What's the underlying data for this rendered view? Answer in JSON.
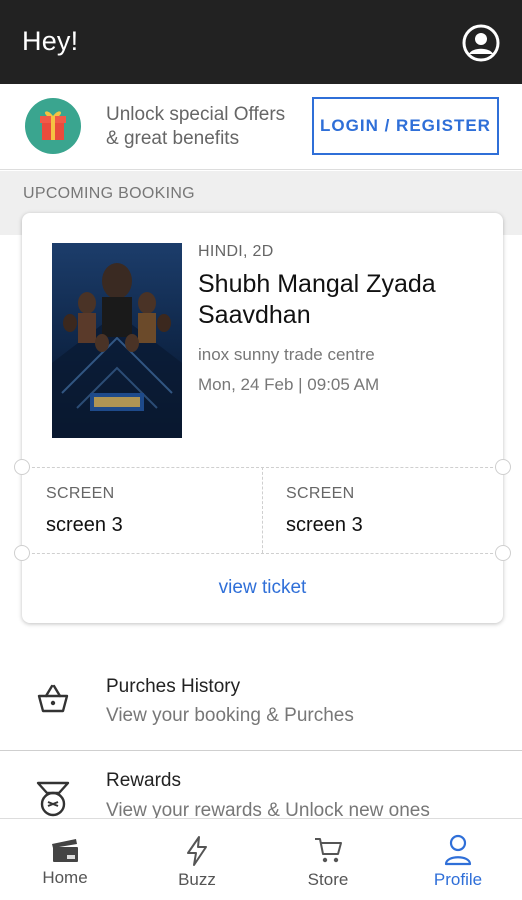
{
  "header": {
    "title": "Hey!",
    "profile_icon": "account-circle-icon"
  },
  "promo": {
    "line1": "Unlock special Offers",
    "line2": "& great benefits",
    "button": "LOGIN / REGISTER",
    "icon": "gift-icon",
    "accent": "#2f6fd8",
    "gift_bg": "#3aa58f"
  },
  "upcoming": {
    "section_label": "UPCOMING BOOKING",
    "format": "HINDI, 2D",
    "movie_line1": "Shubh Mangal Zyada",
    "movie_line2": "Saavdhan",
    "venue": "inox sunny trade centre",
    "datetime": "Mon, 24 Feb | 09:05 AM",
    "screens": [
      {
        "label": "SCREEN",
        "value": "screen 3"
      },
      {
        "label": "SCREEN",
        "value": "screen 3"
      }
    ],
    "view_ticket": "view ticket"
  },
  "menu": [
    {
      "title": "Purches History",
      "subtitle": "View your booking & Purches",
      "icon": "basket-icon"
    },
    {
      "title": "Rewards",
      "subtitle": "View your rewards & Unlock new ones",
      "icon": "medal-icon"
    }
  ],
  "nav": [
    {
      "label": "Home",
      "icon": "cinema-icon",
      "active": false
    },
    {
      "label": "Buzz",
      "icon": "lightning-icon",
      "active": false
    },
    {
      "label": "Store",
      "icon": "cart-icon",
      "active": false
    },
    {
      "label": "Profile",
      "icon": "person-icon",
      "active": true
    }
  ]
}
